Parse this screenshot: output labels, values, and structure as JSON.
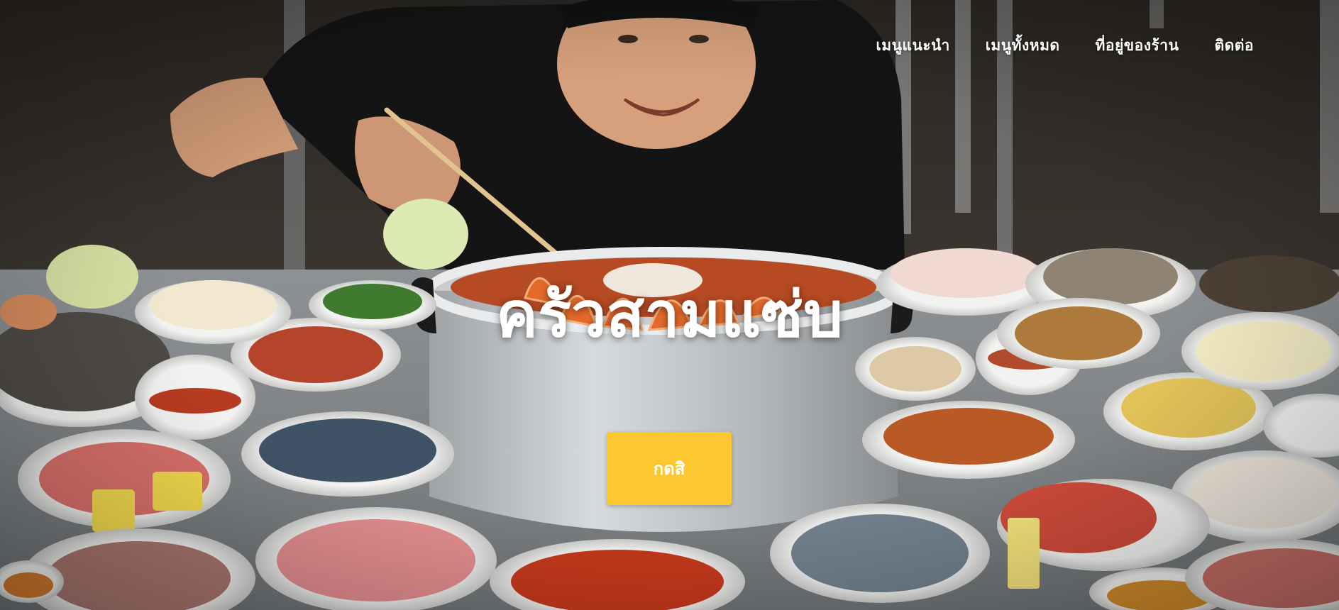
{
  "nav": {
    "items": [
      {
        "label": "เมนูแนะนำ"
      },
      {
        "label": "เมนูทั้งหมด"
      },
      {
        "label": "ที่อยู่ของร้าน"
      },
      {
        "label": "ติดต่อ"
      }
    ]
  },
  "hero": {
    "title": "ครัวสามแซ่บ",
    "cta_label": "กดสิ",
    "background_image": "photo of a smiling man eating seafood hot pot surrounded by plates of raw meat, shrimp, shellfish and salads",
    "colors": {
      "cta": "#fdc82f",
      "text": "#ffffff"
    }
  }
}
